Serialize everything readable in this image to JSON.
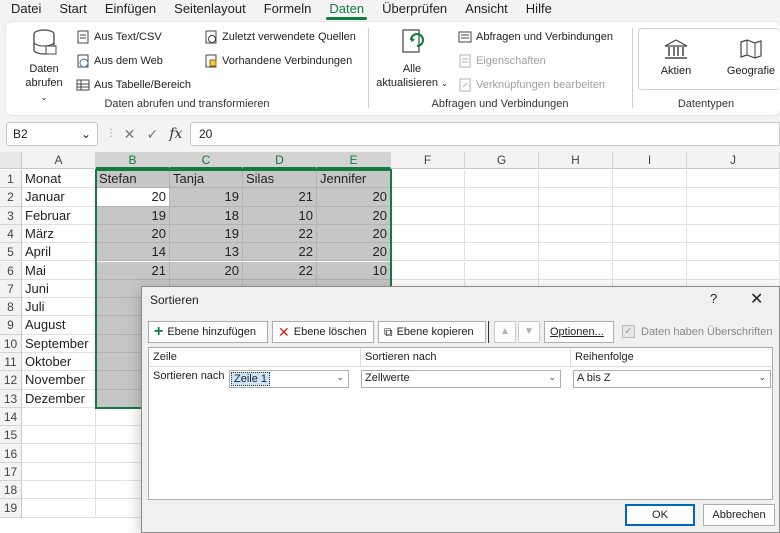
{
  "menu": {
    "items": [
      "Datei",
      "Start",
      "Einfügen",
      "Seitenlayout",
      "Formeln",
      "Daten",
      "Überprüfen",
      "Ansicht",
      "Hilfe"
    ],
    "active": "Daten"
  },
  "ribbon": {
    "groups": {
      "get_data": {
        "label": "Daten abrufen und transformieren",
        "big_button": {
          "line1": "Daten",
          "line2": "abrufen"
        },
        "buttons": [
          "Aus Text/CSV",
          "Aus dem Web",
          "Aus Tabelle/Bereich",
          "Zuletzt verwendete Quellen",
          "Vorhandene Verbindungen"
        ]
      },
      "queries": {
        "label": "Abfragen und Verbindungen",
        "big_button": {
          "line1": "Alle",
          "line2": "aktualisieren"
        },
        "buttons": [
          "Abfragen und Verbindungen",
          "Eigenschaften",
          "Verknüpfungen bearbeiten"
        ]
      },
      "datatypes": {
        "label": "Datentypen",
        "buttons": [
          "Aktien",
          "Geografie"
        ]
      }
    }
  },
  "formula_bar": {
    "name_box": "B2",
    "fx": "fx",
    "formula": "20"
  },
  "sheet": {
    "columns": [
      "A",
      "B",
      "C",
      "D",
      "E",
      "F",
      "G",
      "H",
      "I",
      "J"
    ],
    "rows": [
      "1",
      "2",
      "3",
      "4",
      "5",
      "6",
      "7",
      "8",
      "9",
      "10",
      "11",
      "12",
      "13",
      "14",
      "15",
      "16",
      "17",
      "18",
      "19"
    ],
    "cells": {
      "A": [
        "Monat",
        "Januar",
        "Februar",
        "März",
        "April",
        "Mai",
        "Juni",
        "Juli",
        "August",
        "September",
        "Oktober",
        "November",
        "Dezember"
      ],
      "B": [
        "Stefan",
        "20",
        "19",
        "20",
        "14",
        "21"
      ],
      "C": [
        "Tanja",
        "19",
        "18",
        "19",
        "13",
        "20"
      ],
      "D": [
        "Silas",
        "21",
        "10",
        "22",
        "22",
        "22"
      ],
      "E": [
        "Jennifer",
        "20",
        "20",
        "20",
        "20",
        "10"
      ]
    }
  },
  "dialog": {
    "title": "Sortieren",
    "help": "?",
    "close": "✕",
    "toolbar": {
      "add_level": "Ebene hinzufügen",
      "delete_level": "Ebene löschen",
      "copy_level": "Ebene kopieren",
      "options": "Optionen...",
      "headers_checkbox": "Daten haben Überschriften"
    },
    "table": {
      "headers": {
        "col1": "Zeile",
        "col2": "Sortieren nach",
        "col3": "Reihenfolge"
      },
      "row": {
        "label": "Sortieren nach",
        "row_select": "Zeile 1",
        "sort_on": "Zellwerte",
        "order": "A bis Z"
      }
    },
    "ok": "OK",
    "cancel": "Abbrechen"
  }
}
